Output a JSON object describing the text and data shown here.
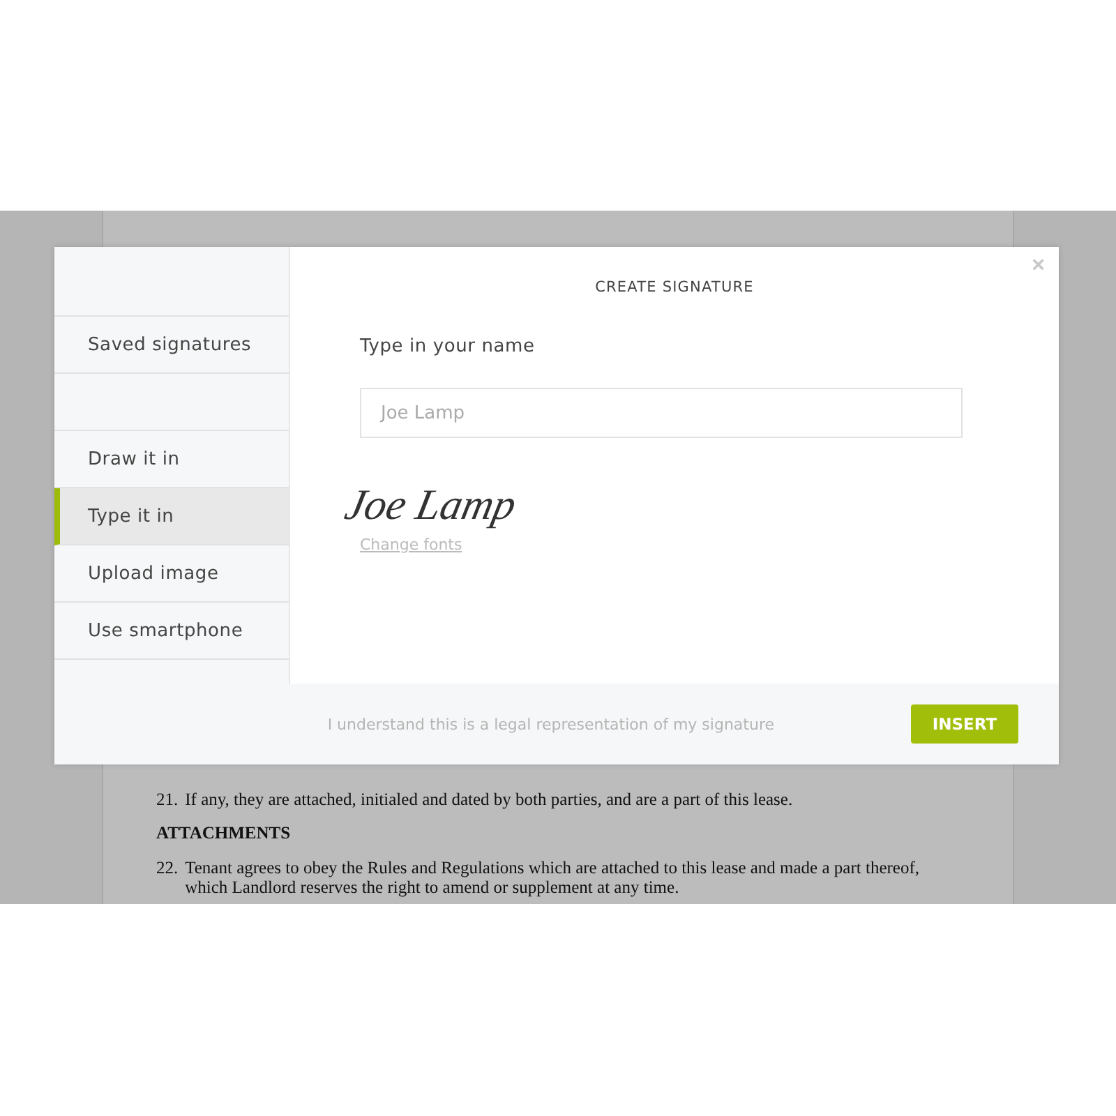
{
  "document": {
    "blocks": [
      {
        "kind": "item",
        "number": "21.",
        "text": "If any, they are attached, initialed and dated by both parties, and are a part of this lease."
      },
      {
        "kind": "heading",
        "text": "ATTACHMENTS"
      },
      {
        "kind": "item",
        "number": "22.",
        "text": "Tenant agrees to obey the Rules and Regulations which are attached to this lease and made a part thereof, which Landlord reserves the right to amend or supplement at any time."
      }
    ]
  },
  "dialog": {
    "title": "CREATE SIGNATURE",
    "close": "×",
    "sidebar": {
      "groups": [
        [
          {
            "label": "Saved signatures",
            "selected": false
          }
        ],
        [
          {
            "label": "Draw it in",
            "selected": false
          },
          {
            "label": "Type it in",
            "selected": true
          },
          {
            "label": "Upload image",
            "selected": false
          },
          {
            "label": "Use smartphone",
            "selected": false
          }
        ]
      ]
    },
    "name_label": "Type in your name",
    "name_value": "Joe Lamp",
    "signature": "Joe Lamp",
    "change_fonts": "Change fonts",
    "footer": {
      "notice": "I understand this is a legal representation of my signature",
      "button": "INSERT"
    }
  }
}
